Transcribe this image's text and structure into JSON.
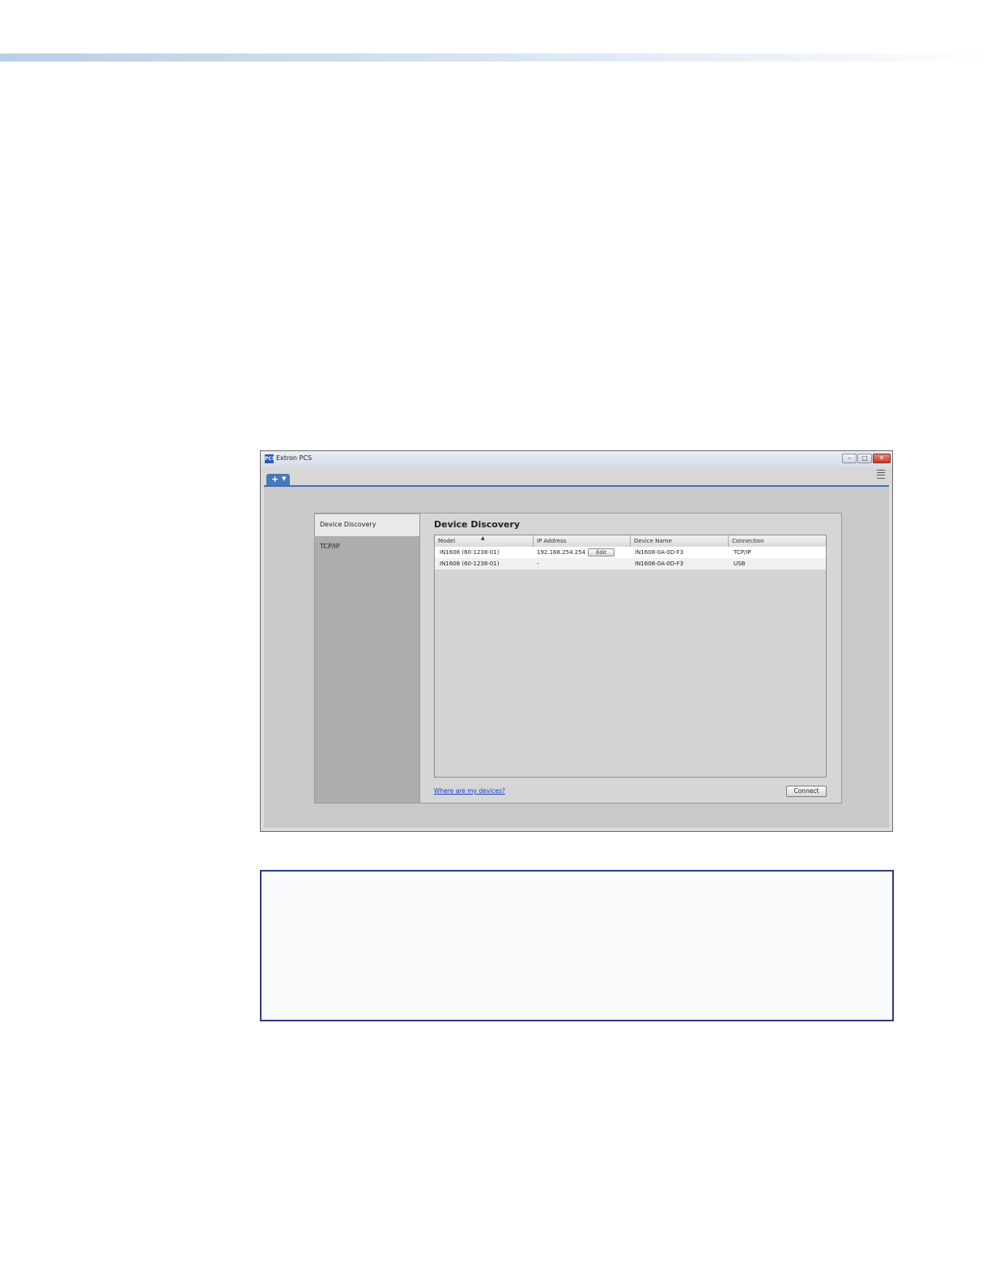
{
  "window": {
    "logo_text": "PCS",
    "title": "Extron PCS",
    "controls": {
      "minimize": "–",
      "maximize": "□",
      "close": "✕"
    }
  },
  "toolbar": {
    "add_tab": "+",
    "add_tab_caret": "▼"
  },
  "sidebar": {
    "items": [
      {
        "label": "Device Discovery",
        "active": true
      },
      {
        "label": "TCP/IP",
        "active": false
      }
    ]
  },
  "content": {
    "title": "Device Discovery",
    "table": {
      "sort_indicator": "▲",
      "columns": [
        "Model",
        "IP Address",
        "Device Name",
        "Connection"
      ],
      "rows": [
        {
          "model": "IN1608 (60-1238-01)",
          "ip": "192.168.254.254",
          "edit": "Edit",
          "device_name": "IN1608-0A-0D-F3",
          "connection": "TCP/IP"
        },
        {
          "model": "IN1608 (60-1238-01)",
          "ip": "-",
          "device_name": "IN1608-0A-0D-F3",
          "connection": "USB"
        }
      ]
    },
    "help_link": "Where are my devices?",
    "connect_button": "Connect"
  },
  "colors": {
    "accent_blue": "#3f72b5",
    "note_border": "#2e3a86",
    "link": "#1a3cc8"
  }
}
